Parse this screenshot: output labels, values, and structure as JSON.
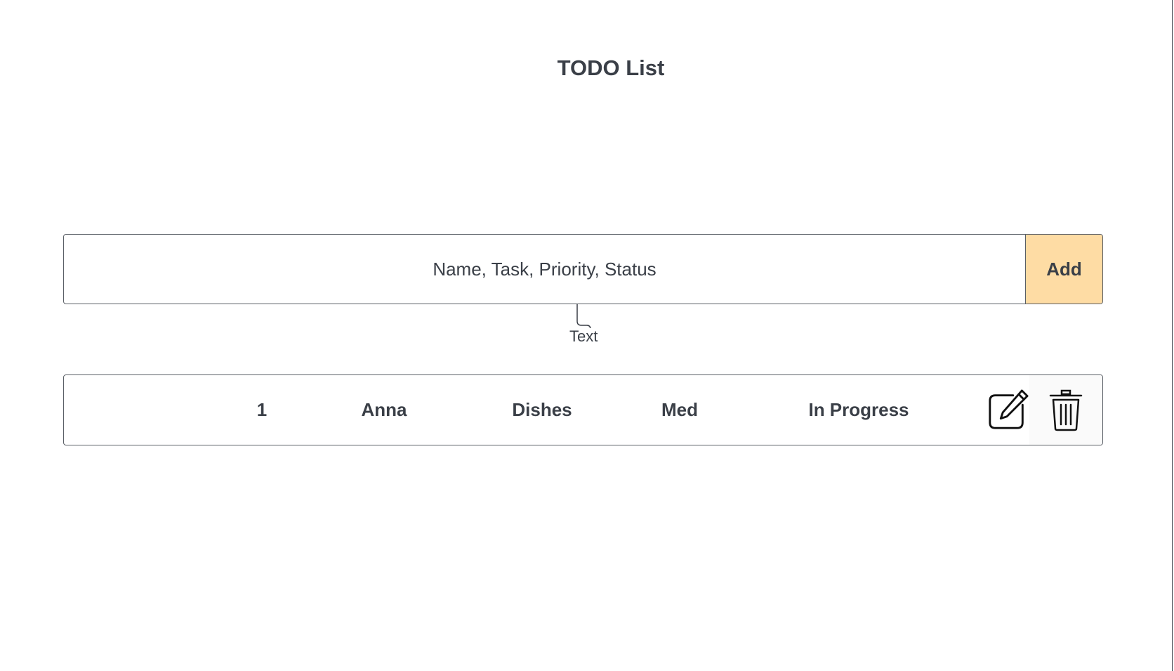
{
  "page": {
    "title": "TODO List"
  },
  "new_task": {
    "placeholder": "Name, Task, Priority, Status",
    "add_label": "Add",
    "add_color": "#fedca4"
  },
  "annotation": {
    "label": "Text"
  },
  "todos": [
    {
      "id": "1",
      "name": "Anna",
      "task": "Dishes",
      "priority": "Med",
      "status": "In Progress",
      "actions": {
        "edit_icon": "edit-icon",
        "delete_icon": "trash-icon"
      }
    }
  ],
  "colors": {
    "text": "#3a3f47",
    "border": "#5a5f66",
    "accent": "#fedca4"
  }
}
